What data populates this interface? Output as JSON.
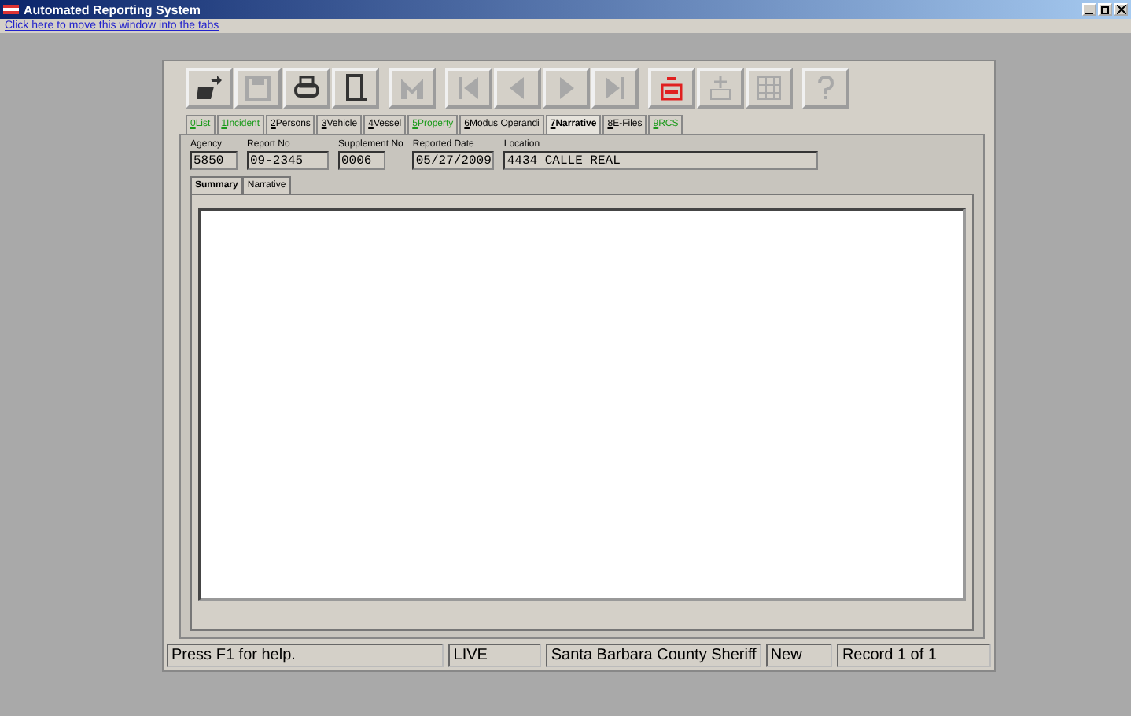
{
  "window": {
    "title": "Automated Reporting System"
  },
  "move_link": "Click here to move this window into the tabs",
  "toolbar": [
    {
      "kind": "open",
      "disabled": false
    },
    {
      "kind": "save",
      "disabled": true
    },
    {
      "kind": "print",
      "disabled": false
    },
    {
      "kind": "door",
      "disabled": false
    },
    {
      "kind": "mail",
      "disabled": true
    },
    {
      "kind": "first",
      "disabled": true
    },
    {
      "kind": "prev",
      "disabled": true
    },
    {
      "kind": "next",
      "disabled": true
    },
    {
      "kind": "last",
      "disabled": true
    },
    {
      "kind": "delete",
      "disabled": false
    },
    {
      "kind": "add",
      "disabled": true
    },
    {
      "kind": "grid",
      "disabled": true
    },
    {
      "kind": "help",
      "disabled": true
    }
  ],
  "tabs": [
    {
      "key": "0",
      "label": "List",
      "selected": false,
      "color": "#1a9a1a"
    },
    {
      "key": "1",
      "label": "Incident",
      "selected": false,
      "color": "#1a9a1a"
    },
    {
      "key": "2",
      "label": "Persons",
      "selected": false,
      "color": "#000000"
    },
    {
      "key": "3",
      "label": "Vehicle",
      "selected": false,
      "color": "#000000"
    },
    {
      "key": "4",
      "label": "Vessel",
      "selected": false,
      "color": "#000000"
    },
    {
      "key": "5",
      "label": "Property",
      "selected": false,
      "color": "#1a9a1a"
    },
    {
      "key": "6",
      "label": "Modus Operandi",
      "selected": false,
      "color": "#000000"
    },
    {
      "key": "7",
      "label": "Narrative",
      "selected": true,
      "color": "#000000"
    },
    {
      "key": "8",
      "label": "E-Files",
      "selected": false,
      "color": "#000000"
    },
    {
      "key": "9",
      "label": "RCS",
      "selected": false,
      "color": "#1a9a1a"
    }
  ],
  "fields": [
    {
      "label": "Agency",
      "value": "5850"
    },
    {
      "label": "Report No",
      "value": "09-2345"
    },
    {
      "label": "Supplement No",
      "value": "0006"
    },
    {
      "label": "Reported Date",
      "value": "05/27/2009"
    },
    {
      "label": "Location",
      "value": "4434 CALLE REAL"
    }
  ],
  "subtabs": [
    {
      "label": "Summary",
      "selected": true
    },
    {
      "label": "Narrative",
      "selected": false
    }
  ],
  "status_bar": [
    "Press F1 for help.",
    "LIVE",
    "Santa Barbara County Sheriff",
    "New",
    "Record 1 of 1"
  ]
}
